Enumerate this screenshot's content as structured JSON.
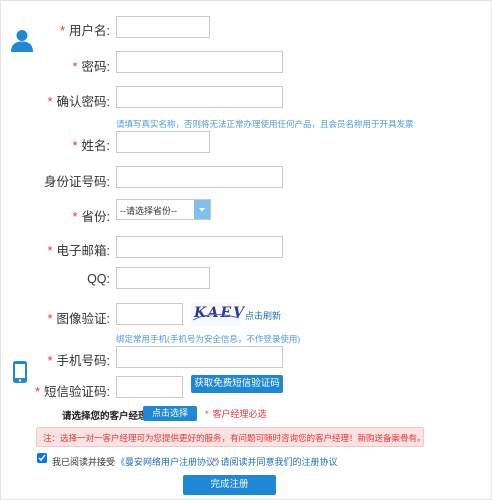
{
  "form": {
    "username_label": "用户名:",
    "password_label": "密码:",
    "confirm_password_label": "确认密码:",
    "name_hint": "请填写真实名称，否则将无法正常办理使用任何产品，且会员名称用于开具发票",
    "realname_label": "姓名:",
    "idcard_label": "身份证号码:",
    "province_label": "省份:",
    "province_selected": "--请选择省份--",
    "email_label": "电子邮箱:",
    "qq_label": "QQ:",
    "captcha_label": "图像验证:",
    "captcha_text": "KAEV",
    "captcha_refresh": "点击刷新",
    "phone_hint": "绑定常用手机(手机号为安全信息，不作登录使用)",
    "phone_label": "手机号码:",
    "sms_label": "短信验证码:",
    "sms_button": "获取免费短信验证码",
    "manager_label": "请选择您的客户经理：",
    "manager_button": "点击选择",
    "manager_required": "客户经理必选",
    "notice": "注：选择一对一客户经理可为您提供更好的服务，有问题可随时咨询您的客户经理！新购送备案骨有。",
    "agree_prefix": "我已阅读并接受",
    "agreement_link": "《曼安网络用户注册协议》",
    "agree_warning": "请阅读并同意我们的注册协议",
    "submit_button": "完成注册",
    "required_mark": "*"
  },
  "icons": {
    "user": "user-icon",
    "phone": "phone-icon",
    "dropdown": "dropdown-arrow-icon"
  },
  "colors": {
    "accent": "#1e88d6",
    "required": "#e33333",
    "hint": "#4f9bd8",
    "notice_bg": "#fbe3e3"
  }
}
